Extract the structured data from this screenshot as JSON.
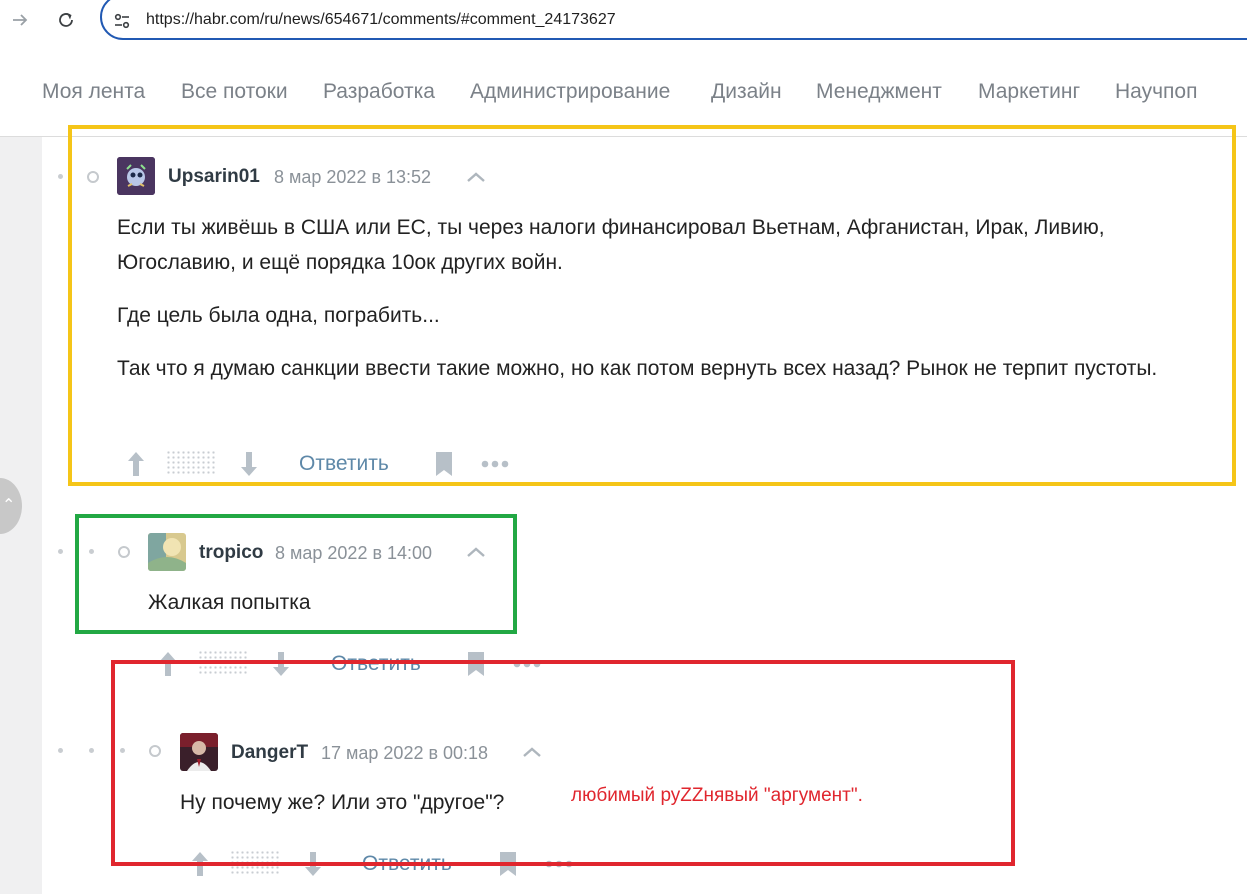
{
  "browser": {
    "url": "https://habr.com/ru/news/654671/comments/#comment_24173627",
    "forward_icon": "arrow-right",
    "reload_icon": "reload"
  },
  "nav": {
    "items": [
      "Моя лента",
      "Все потоки",
      "Разработка",
      "Администрирование",
      "Дизайн",
      "Менеджмент",
      "Маркетинг",
      "Научпоп"
    ]
  },
  "comments": [
    {
      "username": "Upsarin01",
      "timestamp": "8 мар 2022 в 13:52",
      "paragraphs": [
        "Если ты живёшь в США или ЕС, ты через налоги финансировал Вьетнам, Афганистан, Ирак, Ливию, Югославию, и ещё порядка 10ок других войн.",
        "Где цель была одна, пограбить...",
        "Так что я думаю санкции ввести такие можно, но как потом вернуть всех назад? Рынок не терпит пустоты."
      ],
      "reply_label": "Ответить"
    },
    {
      "username": "tropico",
      "timestamp": "8 мар 2022 в 14:00",
      "paragraphs": [
        "Жалкая попытка"
      ],
      "reply_label": "Ответить"
    },
    {
      "username": "DangerT",
      "timestamp": "17 мар 2022 в 00:18",
      "paragraphs": [
        "Ну почему же? Или это \"другое\"?"
      ],
      "reply_label": "Ответить"
    }
  ],
  "annotations": {
    "note": "любимый руZZнявый \"аргумент\".",
    "colors": {
      "yellow": "#f5c518",
      "green": "#22a844",
      "red": "#e0262e"
    }
  }
}
